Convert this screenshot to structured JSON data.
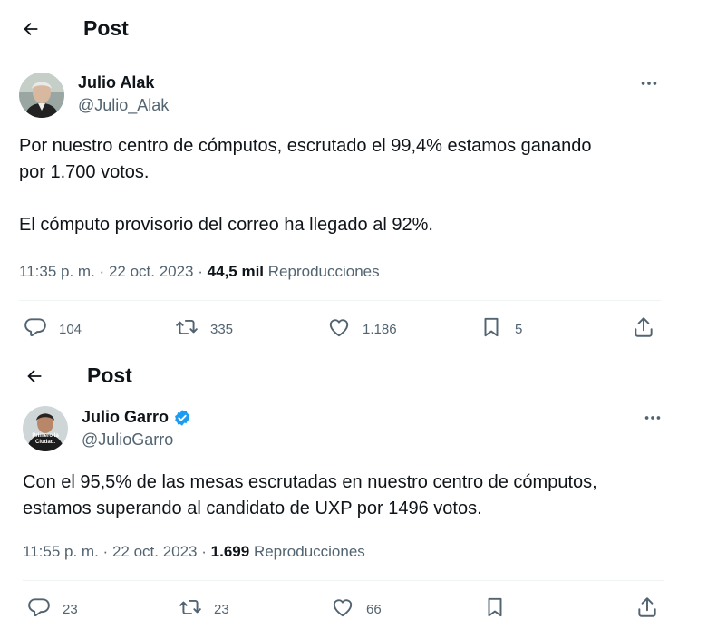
{
  "post1": {
    "header_title": "Post",
    "author_name": "Julio Alak",
    "author_handle": "@Julio_Alak",
    "text": "Por nuestro centro de cómputos, escrutado el 99,4% estamos ganando\npor 1.700 votos.\n\nEl cómputo provisorio del correo ha llegado al 92%.",
    "time": "11:35 p. m.",
    "date": "22 oct. 2023",
    "views": "44,5 mil",
    "views_label": "Reproducciones",
    "replies": "104",
    "reposts": "335",
    "likes": "1.186",
    "bookmarks": "5"
  },
  "post2": {
    "header_title": "Post",
    "author_name": "Julio Garro",
    "author_handle": "@JulioGarro",
    "avatar_caption": "Primero la Ciudad.",
    "text": "Con el 95,5% de las mesas escrutadas en nuestro centro de cómputos,\nestamos superando al candidato de UXP por 1496 votos.",
    "time": "11:55 p. m.",
    "date": "22 oct. 2023",
    "views": "1.699",
    "views_label": "Reproducciones",
    "replies": "23",
    "reposts": "23",
    "likes": "66"
  },
  "separator": "·",
  "colors": {
    "verified": "#1d9bf0",
    "secondary_text": "#536471",
    "primary_text": "#0f1419"
  }
}
